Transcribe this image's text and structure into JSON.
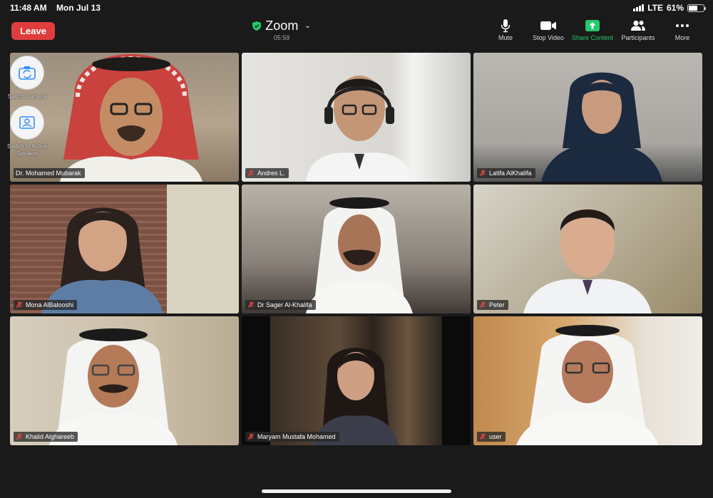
{
  "status_bar": {
    "time": "11:48 AM",
    "date": "Mon Jul 13",
    "network": "LTE",
    "battery": "61%",
    "battery_level": 0.61
  },
  "toolbar": {
    "leave_label": "Leave",
    "app_title": "Zoom",
    "timer": "05:59",
    "mute_label": "Mute",
    "stop_video_label": "Stop Video",
    "share_label": "Share Content",
    "participants_label": "Participants",
    "more_label": "More"
  },
  "overlay": {
    "switch_camera_label": "Switch Camera",
    "switch_speaker_label": "Switch to Active Speaker"
  },
  "participants": [
    {
      "name": "Dr. Mohamed Mubarak",
      "muted": false
    },
    {
      "name": "Andres L.",
      "muted": true
    },
    {
      "name": "Latifa AlKhalifa",
      "muted": true
    },
    {
      "name": "Mona AlBalooshi",
      "muted": true
    },
    {
      "name": "Dr Sager Al-Khalifa",
      "muted": true
    },
    {
      "name": "Peter",
      "muted": true
    },
    {
      "name": "Khalid Alghareeb",
      "muted": true
    },
    {
      "name": "Maryam Mustafa Mohamed",
      "muted": true
    },
    {
      "name": "user",
      "muted": true
    }
  ],
  "colors": {
    "leave": "#e03e3e",
    "share": "#23c96b",
    "background": "#1a1a1a",
    "mute_icon": "#e04545"
  }
}
